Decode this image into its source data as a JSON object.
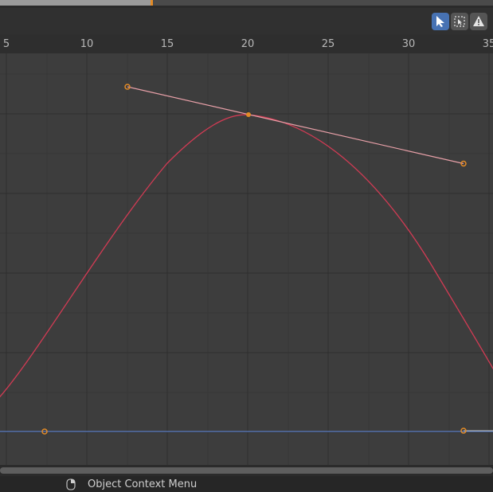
{
  "header": {
    "tools": [
      {
        "name": "select-tool",
        "icon": "cursor-arrow-icon",
        "active": true
      },
      {
        "name": "box-select-tool",
        "icon": "box-select-icon",
        "active": false
      },
      {
        "name": "warning-tool",
        "icon": "warning-icon",
        "active": false
      }
    ]
  },
  "ruler": {
    "labels": [
      "5",
      "10",
      "15",
      "20",
      "25",
      "30",
      "35"
    ]
  },
  "graph": {
    "curve_color": "#d23b54",
    "flat_curve_color": "#5b7ec4",
    "handle_color": "#e38b26",
    "handle_line_color": "#e8a0a8"
  },
  "status_bar": {
    "mouse_icon": "mouse-right-click-icon",
    "context_menu_label": "Object Context Menu"
  }
}
